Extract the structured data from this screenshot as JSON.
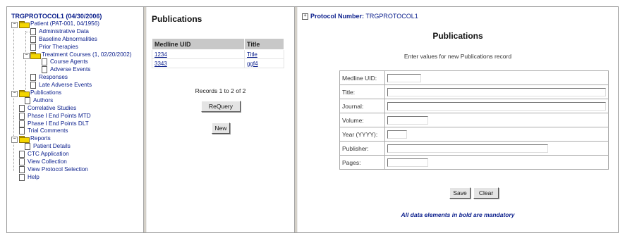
{
  "tree": {
    "title": "TRGPROTOCOL1 (04/30/2006)",
    "nodes": [
      {
        "label": "Patient (PAT-001, 04/1956)"
      },
      {
        "label": "Administrative Data"
      },
      {
        "label": "Baseline Abnormalities"
      },
      {
        "label": "Prior Therapies"
      },
      {
        "label": "Treatment Courses (1, 02/20/2002)"
      },
      {
        "label": "Course Agents"
      },
      {
        "label": "Adverse Events"
      },
      {
        "label": "Responses"
      },
      {
        "label": "Late Adverse Events"
      },
      {
        "label": "Publications"
      },
      {
        "label": "Authors"
      },
      {
        "label": "Correlative Studies"
      },
      {
        "label": "Phase I End Points MTD"
      },
      {
        "label": "Phase I End Points DLT"
      },
      {
        "label": "Trial Comments"
      },
      {
        "label": "Reports"
      },
      {
        "label": "Patient Details"
      },
      {
        "label": "CTC Application"
      },
      {
        "label": "View Collection"
      },
      {
        "label": "View Protocol Selection"
      },
      {
        "label": "Help"
      }
    ]
  },
  "middle": {
    "title": "Publications",
    "columns": [
      "Medline UID",
      "Title"
    ],
    "rows": [
      {
        "uid": "1234",
        "title": "Title"
      },
      {
        "uid": "3343",
        "title": "ggf4"
      }
    ],
    "records_text": "Records 1 to 2 of 2",
    "requery_label": "ReQuery",
    "new_label": "New"
  },
  "right": {
    "protocol_label": "Protocol Number:",
    "protocol_value": "TRGPROTOCOL1",
    "expand_glyph": "+",
    "title": "Publications",
    "instruction": "Enter values for new Publications record",
    "fields": [
      {
        "label": "Medline UID:",
        "value": ""
      },
      {
        "label": "Title:",
        "value": ""
      },
      {
        "label": "Journal:",
        "value": ""
      },
      {
        "label": "Volume:",
        "value": ""
      },
      {
        "label": "Year (YYYY):",
        "value": ""
      },
      {
        "label": "Publisher:",
        "value": ""
      },
      {
        "label": "Pages:",
        "value": ""
      }
    ],
    "save_label": "Save",
    "clear_label": "Clear",
    "mandatory_note": "All data elements in bold are mandatory"
  },
  "colors": {
    "link": "#0a1e8c",
    "header_bg": "#c8c8c8",
    "divider": "#d4d0c8",
    "folder": "#f4d600"
  }
}
